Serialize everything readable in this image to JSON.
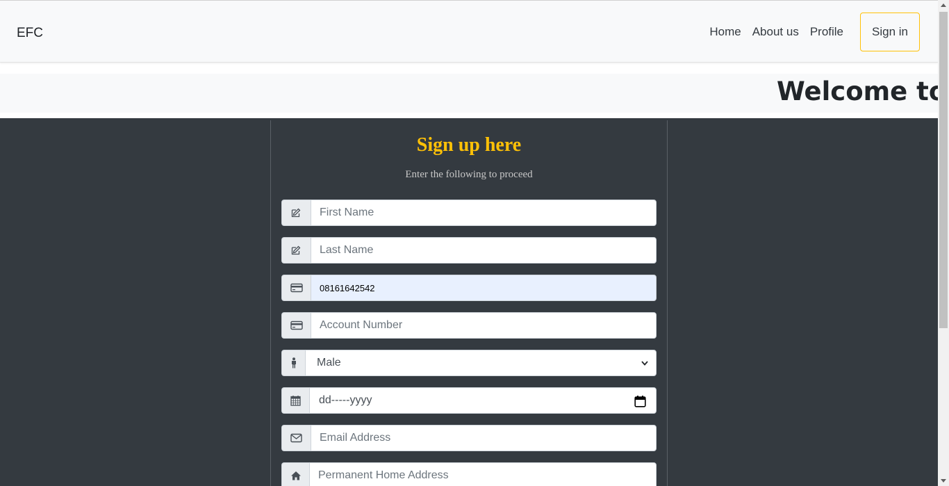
{
  "navbar": {
    "brand": "EFC",
    "links": [
      "Home",
      "About us",
      "Profile"
    ],
    "signin_label": "Sign in",
    "accent_color": "#ffc107"
  },
  "marquee": {
    "text": "Welcome to"
  },
  "form": {
    "title": "Sign up here",
    "subtitle": "Enter the following to proceed",
    "first_name_placeholder": "First Name",
    "last_name_placeholder": "Last Name",
    "phone_value": "08161642542",
    "account_number_placeholder": "Account Number",
    "gender_selected": "Male",
    "dob_placeholder": "dd-----yyyy",
    "email_placeholder": "Email Address",
    "address_placeholder": "Permanent Home Address"
  },
  "icons": {
    "first_name": "edit-icon",
    "last_name": "edit-icon",
    "phone": "credit-card-icon",
    "account": "credit-card-icon",
    "gender": "male-person-icon",
    "dob": "calendar-icon",
    "email": "envelope-icon",
    "address": "home-icon"
  }
}
